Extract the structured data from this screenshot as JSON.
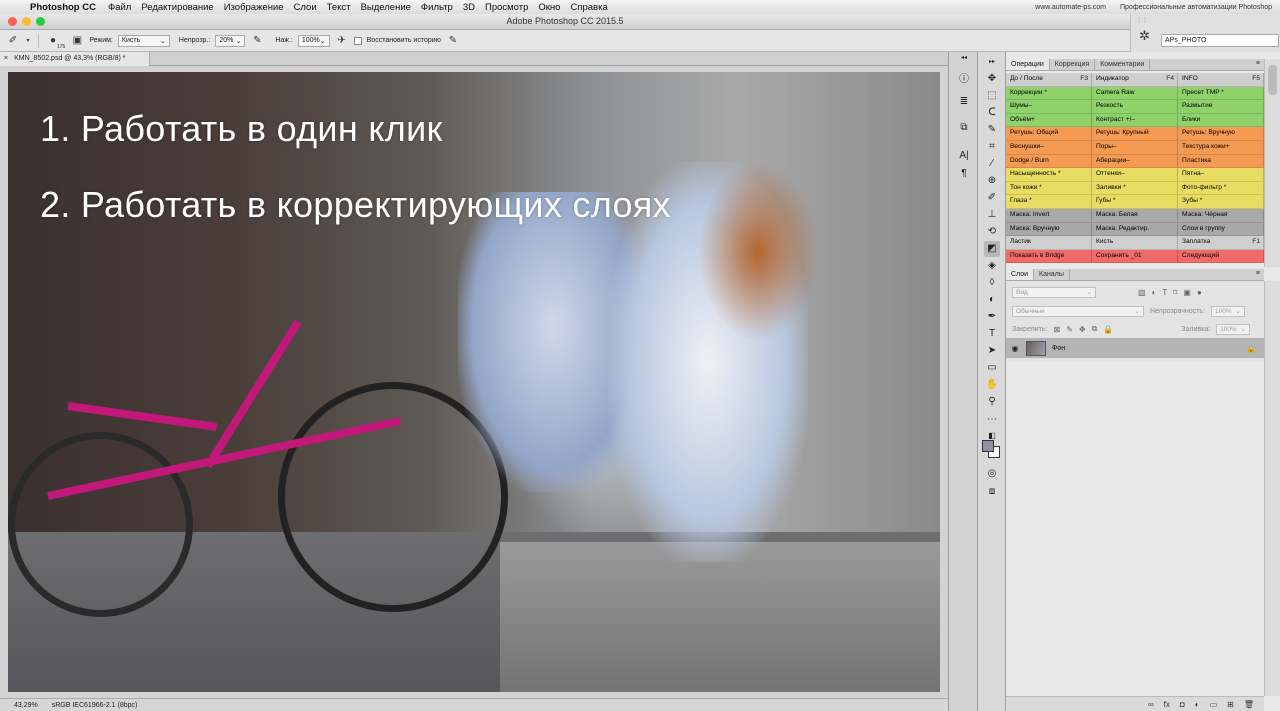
{
  "menubar": {
    "app_name": "Photoshop CC",
    "items": [
      "Файл",
      "Редактирование",
      "Изображение",
      "Слои",
      "Текст",
      "Выделение",
      "Фильтр",
      "3D",
      "Просмотр",
      "Окно",
      "Справка"
    ],
    "right_url": "www.automate-ps.com",
    "right_tagline": "Профессиональные автоматизации Photoshop"
  },
  "window": {
    "title": "Adobe Photoshop CC 2015.5",
    "traffic_colors": [
      "#fc5f57",
      "#fdbc2e",
      "#2ac940"
    ]
  },
  "options_bar": {
    "brush_size": "175",
    "mode_label": "Режим:",
    "mode_value": "Кисть",
    "opacity_label": "Непрозр.:",
    "opacity_value": "20%",
    "flow_label": "Наж.:",
    "flow_value": "100%",
    "history_label": "Восстановить историю"
  },
  "workspace": {
    "value": "APs_PHOTO"
  },
  "document": {
    "tab_title": "KMN_8502.psd @ 43,3% (RGB/8) *",
    "slide_lines": [
      "1. Работать в один клик",
      "2. Работать в корректирующих слоях"
    ]
  },
  "status_bar": {
    "zoom": "43,29%",
    "profile": "sRGB IEC61966-2.1 (8bpc)"
  },
  "actions_panel": {
    "tabs": [
      "Операции",
      "Коррекция",
      "Комментарии"
    ],
    "active_tab": "Операции",
    "rows": [
      {
        "color": "#cfcfcf",
        "cells": [
          [
            "До / После",
            "F3"
          ],
          [
            "Индикатор",
            "F4"
          ],
          [
            "INFO",
            "F5"
          ]
        ]
      },
      {
        "color": "#8fd16a",
        "cells": [
          [
            "Коррекции *",
            ""
          ],
          [
            "Camera Raw",
            ""
          ],
          [
            "Пресет TMP *",
            ""
          ]
        ]
      },
      {
        "color": "#8fd16a",
        "cells": [
          [
            "Шумы–",
            ""
          ],
          [
            "Резкость",
            ""
          ],
          [
            "Размытие",
            ""
          ]
        ]
      },
      {
        "color": "#8fd16a",
        "cells": [
          [
            "Объём+",
            ""
          ],
          [
            "Контраст +/–",
            ""
          ],
          [
            "Блики",
            ""
          ]
        ]
      },
      {
        "color": "#f59a52",
        "cells": [
          [
            "Ретушь: Общий",
            ""
          ],
          [
            "Ретушь: Крупный",
            ""
          ],
          [
            "Ретушь: Вручную",
            ""
          ]
        ]
      },
      {
        "color": "#f59a52",
        "cells": [
          [
            "Веснушки–",
            ""
          ],
          [
            "Поры–",
            ""
          ],
          [
            "Текстура кожи+",
            ""
          ]
        ]
      },
      {
        "color": "#f59a52",
        "cells": [
          [
            "Dodge / Burn",
            ""
          ],
          [
            "Аберации–",
            ""
          ],
          [
            "Пластика",
            ""
          ]
        ]
      },
      {
        "color": "#e9dc62",
        "cells": [
          [
            "Насыщенность *",
            ""
          ],
          [
            "Оттенки–",
            ""
          ],
          [
            "Пятна–",
            ""
          ]
        ]
      },
      {
        "color": "#e9dc62",
        "cells": [
          [
            "Тон кожи *",
            ""
          ],
          [
            "Заливки *",
            ""
          ],
          [
            "Фото-фильтр *",
            ""
          ]
        ]
      },
      {
        "color": "#e9dc62",
        "cells": [
          [
            "Глаза *",
            ""
          ],
          [
            "Губы *",
            ""
          ],
          [
            "Зубы *",
            ""
          ]
        ]
      },
      {
        "color": "#a8a8a8",
        "cells": [
          [
            "Маска: Invert",
            ""
          ],
          [
            "Маска: Белая",
            ""
          ],
          [
            "Маска: Чёрная",
            ""
          ]
        ]
      },
      {
        "color": "#a8a8a8",
        "cells": [
          [
            "Маска: Вручную",
            ""
          ],
          [
            "Маска: Редактир.",
            ""
          ],
          [
            "Слои в группу",
            ""
          ]
        ]
      },
      {
        "color": "#cfcfcf",
        "cells": [
          [
            "Ластик",
            ""
          ],
          [
            "Кисть",
            ""
          ],
          [
            "Заплатка",
            "F1"
          ]
        ]
      },
      {
        "color": "#f26b6b",
        "cells": [
          [
            "Показать в Bridge",
            ""
          ],
          [
            "Сохранить _01",
            ""
          ],
          [
            "Следующий",
            ""
          ]
        ]
      }
    ]
  },
  "layers_panel": {
    "tabs": [
      "Слои",
      "Каналы"
    ],
    "active_tab": "Слои",
    "filter_kind": "Вид",
    "blend_mode": "Обычные",
    "opacity_label": "Непрозрачность:",
    "opacity_value": "100%",
    "lock_label": "Закрепить:",
    "fill_label": "Заливка:",
    "fill_value": "100%",
    "layers": [
      {
        "name": "Фон",
        "visible": true,
        "locked": true
      }
    ]
  }
}
